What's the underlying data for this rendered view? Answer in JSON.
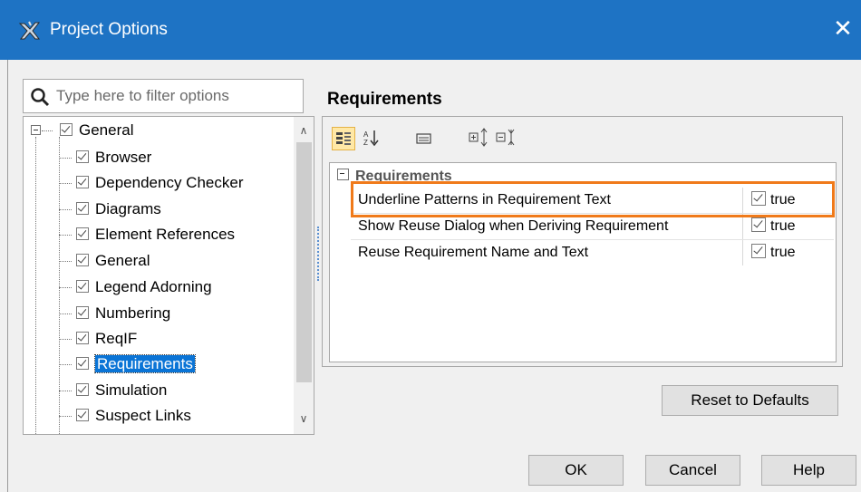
{
  "window": {
    "title": "Project Options",
    "close_glyph": "✕",
    "titlebar_color": "#1e73c4"
  },
  "search": {
    "placeholder": "Type here to filter options",
    "value": ""
  },
  "tree": {
    "root": {
      "label": "General",
      "checked": true,
      "expanded": true
    },
    "items": [
      {
        "label": "Browser",
        "checked": true
      },
      {
        "label": "Dependency Checker",
        "checked": true
      },
      {
        "label": "Diagrams",
        "checked": true
      },
      {
        "label": "Element References",
        "checked": true
      },
      {
        "label": "General",
        "checked": true
      },
      {
        "label": "Legend Adorning",
        "checked": true
      },
      {
        "label": "Numbering",
        "checked": true
      },
      {
        "label": "ReqIF",
        "checked": true
      },
      {
        "label": "Requirements",
        "checked": true,
        "selected": true
      },
      {
        "label": "Simulation",
        "checked": true
      },
      {
        "label": "Suspect Links",
        "checked": true
      }
    ],
    "selection_color": "#0a74d6"
  },
  "right": {
    "title": "Requirements",
    "toolbar": [
      "categorized-view-icon",
      "sort-alphabetically-icon",
      "description-icon",
      "expand-all-icon",
      "collapse-all-icon"
    ],
    "group": {
      "label": "Requirements"
    },
    "properties": [
      {
        "name": "Underline Patterns in Requirement Text",
        "value": "true",
        "checked": true,
        "highlighted": true
      },
      {
        "name": "Show Reuse Dialog when Deriving Requirement",
        "value": "true",
        "checked": true
      },
      {
        "name": "Reuse Requirement Name and Text",
        "value": "true",
        "checked": true
      }
    ],
    "highlight_color": "#f07a1a"
  },
  "buttons": {
    "reset": "Reset to Defaults",
    "ok": "OK",
    "cancel": "Cancel",
    "help": "Help"
  }
}
